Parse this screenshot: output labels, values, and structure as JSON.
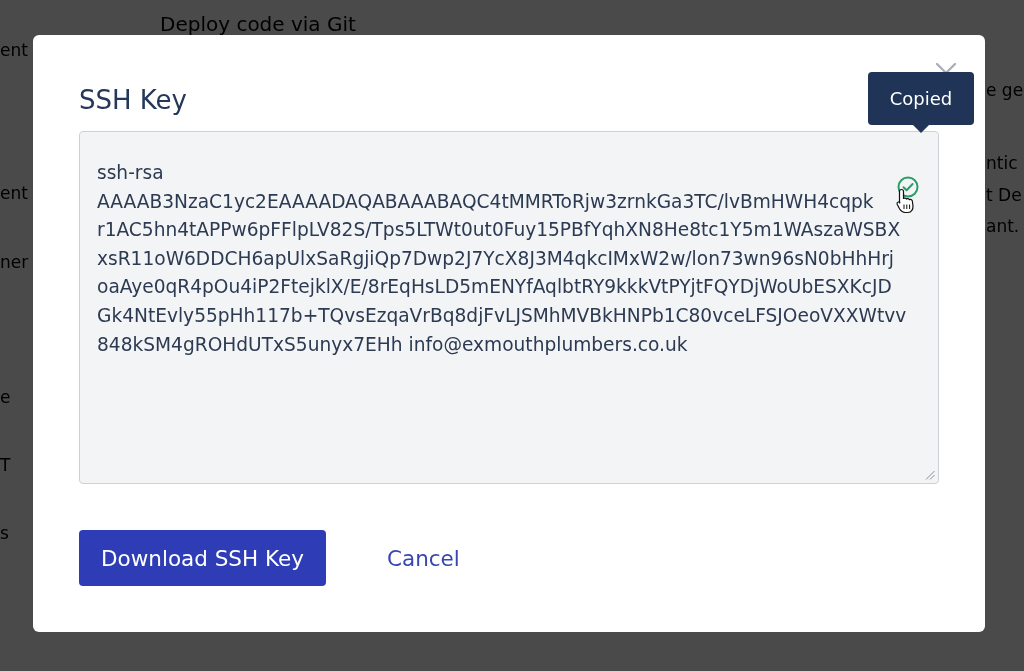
{
  "background_page": {
    "heading": "Deploy code via Git",
    "left_fragments": [
      "ent",
      "ent",
      "ner",
      "e",
      "T",
      "s"
    ],
    "right_fragments": [
      "e ge",
      "ntic",
      "t De",
      "ant."
    ]
  },
  "dialog": {
    "title": "SSH Key",
    "key_field": {
      "lines": [
        "ssh-rsa",
        "AAAAB3NzaC1yc2EAAAADAQABAAABAQC4tMMRToRjw3zrnkGa3TC/lvBmHWH4cqpk",
        "r1AC5hn4tAPPw6pFFlpLV82S/Tps5LTWt0ut0Fuy15PBfYqhXN8He8tc1Y5m1WAszaWSBX",
        "xsR11oW6DDCH6apUlxSaRgjiQp7Dwp2J7YcX8J3M4qkcIMxW2w/lon73wn96sN0bHhHrj",
        "oaAye0qR4pOu4iP2FtejklX/E/8rEqHsLD5mENYfAqlbtRY9kkkVtPYjtFQYDjWoUbESXKcJD",
        "Gk4NtEvly55pHh117b+TQvsEzqaVrBq8djFvLJSMhMVBkHNPb1C80vceLFSJOeoVXXWtvv",
        "848kSM4gROHdUTxS5unyx7EHh info@exmouthplumbers.co.uk"
      ],
      "copied": true
    },
    "tooltip": "Copied",
    "buttons": [
      {
        "label": "Download SSH Key",
        "kind": "primary"
      },
      {
        "label": "Cancel",
        "kind": "link"
      }
    ]
  }
}
